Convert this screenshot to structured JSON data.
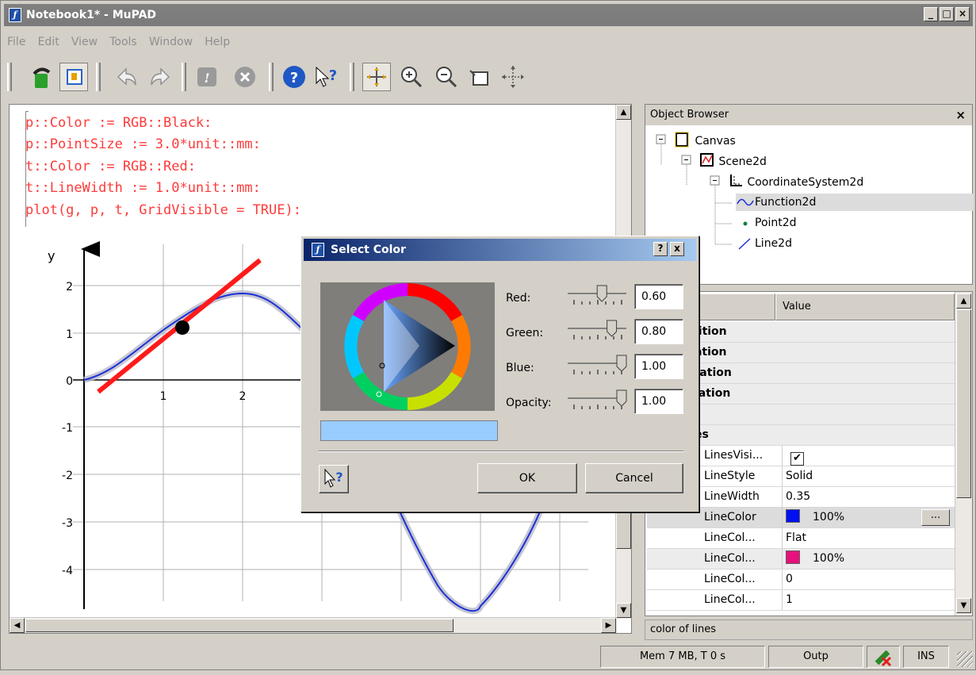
{
  "window": {
    "title": "Notebook1* - MuPAD",
    "app_icon": "mupad-icon"
  },
  "menu": [
    "File",
    "Edit",
    "View",
    "Tools",
    "Window",
    "Help"
  ],
  "toolbar": {
    "icons": [
      "open-icon",
      "toggle-icon",
      "undo-icon",
      "redo-icon",
      "evaluate-icon",
      "stop-icon",
      "help-icon",
      "context-help-icon",
      "pointer-icon",
      "zoom-in-icon",
      "zoom-out-icon",
      "crop-icon",
      "move-icon"
    ]
  },
  "notebook": {
    "code_lines": [
      "p::Color := RGB::Black:",
      "p::PointSize := 3.0*unit::mm:",
      "t::Color := RGB::Red:",
      "t::LineWidth := 1.0*unit::mm:",
      "plot(g, p, t, GridVisible = TRUE):"
    ],
    "plot": {
      "y_axis_label": "y",
      "x_ticks": [
        "1",
        "2"
      ],
      "y_ticks": [
        "2",
        "1",
        "0",
        "-1",
        "-2",
        "-3",
        "-4"
      ]
    }
  },
  "object_browser": {
    "title": "Object Browser",
    "close": "×",
    "tree": [
      {
        "label": "Canvas",
        "icon": "canvas-icon"
      },
      {
        "label": "Scene2d",
        "icon": "scene-icon"
      },
      {
        "label": "CoordinateSystem2d",
        "icon": "axes-icon"
      },
      {
        "label": "Function2d",
        "icon": "function-icon"
      },
      {
        "label": "Point2d",
        "icon": "point-icon"
      },
      {
        "label": "Line2d",
        "icon": "line-icon"
      }
    ]
  },
  "properties": {
    "header_key_partial": "y",
    "header_value": "Value",
    "groups": [
      "inition",
      "nation",
      "otation",
      "ulation",
      "e",
      "nes"
    ],
    "rows": [
      {
        "key": "LinesVisi...",
        "value": "",
        "checkbox": "✔"
      },
      {
        "key": "LineStyle",
        "value": "Solid"
      },
      {
        "key": "LineWidth",
        "value": "0.35"
      },
      {
        "key": "LineColor",
        "value": "100%",
        "swatch": "#0010f0",
        "button": "..."
      },
      {
        "key": "LineCol...",
        "value": "Flat"
      },
      {
        "key": "LineCol...",
        "value": "100%",
        "swatch": "#e8107c"
      },
      {
        "key": "LineCol...",
        "value": "0"
      },
      {
        "key": "LineCol...",
        "value": "1"
      }
    ],
    "description": "color of lines"
  },
  "statusbar": {
    "memory": "Mem 7 MB, T 0 s",
    "output": "Outp",
    "mode": "INS"
  },
  "dialog": {
    "title": "Select Color",
    "help_btn": "?",
    "close_btn": "x",
    "channels": [
      {
        "label": "Red:",
        "value": "0.60",
        "level": 0.6
      },
      {
        "label": "Green:",
        "value": "0.80",
        "level": 0.8
      },
      {
        "label": "Blue:",
        "value": "1.00",
        "level": 1.0
      },
      {
        "label": "Opacity:",
        "value": "1.00",
        "level": 1.0
      }
    ],
    "preview_color": "#99ccff",
    "ok": "OK",
    "cancel": "Cancel"
  }
}
